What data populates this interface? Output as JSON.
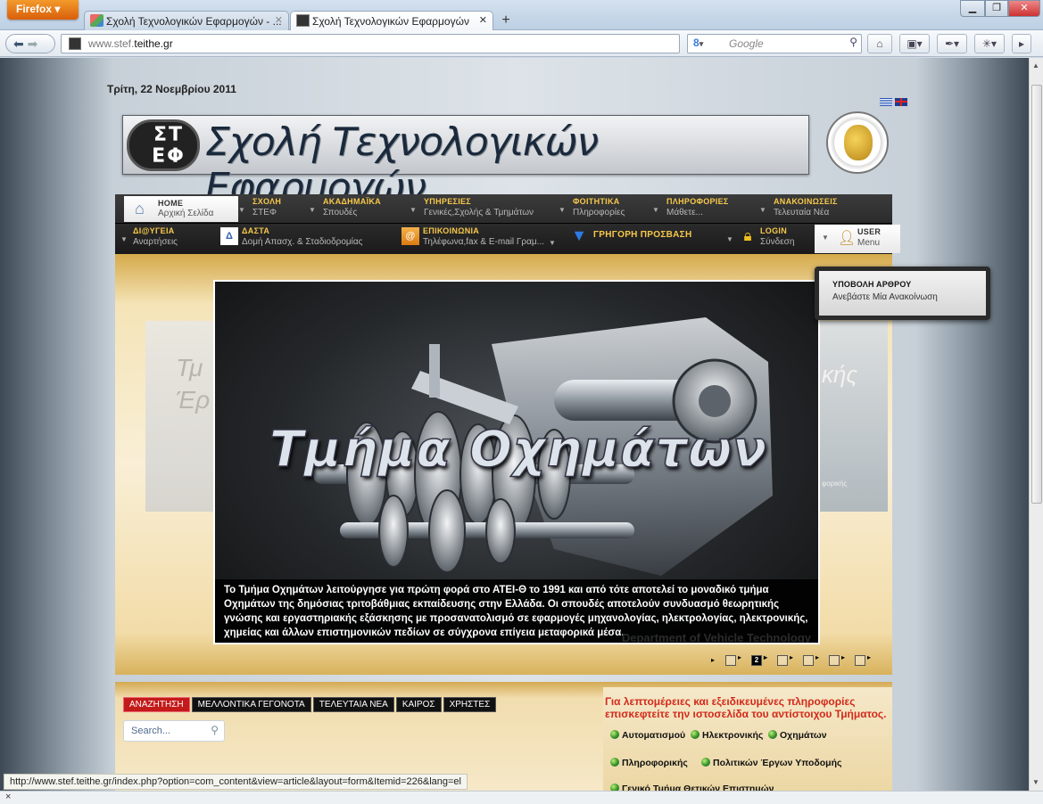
{
  "browser": {
    "app_button": "Firefox",
    "tabs": [
      {
        "title": "Σχολή Τεχνολογικών Εφαρμογών - ..."
      },
      {
        "title": "Σχολή Τεχνολογικών Εφαρμογών"
      }
    ],
    "new_tab": "+",
    "url_prefix": "www.stef.",
    "url_host": "teithe.gr",
    "search_engine": "Google",
    "search_placeholder": "Google",
    "status_url": "http://www.stef.teithe.gr/index.php?option=com_content&view=article&layout=form&Itemid=226&lang=el",
    "statusbar_close": "×"
  },
  "site": {
    "date": "Τρίτη, 22 Νοεμβρίου 2011",
    "banner_logo": "ΣΤ ΕΦ",
    "banner_title": "Σχολή Τεχνολογικών Εφαρμογών",
    "nav_row1": [
      {
        "title": "HOME",
        "sub": "Αρχική Σελίδα"
      },
      {
        "title": "ΣΧΟΛΗ",
        "sub": "ΣΤΕΦ"
      },
      {
        "title": "ΑΚΑΔΗΜΑΪΚΑ",
        "sub": "Σπουδές"
      },
      {
        "title": "ΥΠΗΡΕΣΙΕΣ",
        "sub": "Γενικές,Σχολής & Τμημάτων"
      },
      {
        "title": "ΦΟΙΤΗΤΙΚΑ",
        "sub": "Πληροφορίες"
      },
      {
        "title": "ΠΛΗΡΟΦΟΡΙΕΣ",
        "sub": "Μάθετε..."
      },
      {
        "title": "ΑΝΑΚΟΙΝΩΣΕΙΣ",
        "sub": "Τελευταία Νέα"
      }
    ],
    "nav_row2": [
      {
        "title": "ΔΙ@ΥΓΕΙΑ",
        "sub": "Αναρτήσεις"
      },
      {
        "title": "ΔΑΣΤΑ",
        "sub": "Δομή Απασχ. & Σταδιοδρομίας"
      },
      {
        "title": "ΕΠΙΚΟΙΝΩΝΙΑ",
        "sub": "Τηλέφωνα,fax & E-mail Γραμ..."
      },
      {
        "title": "ΓΡΗΓΟΡΗ ΠΡΟΣΒΑΣΗ",
        "sub": ""
      },
      {
        "title": "LOGIN",
        "sub": "Σύνδεση"
      },
      {
        "title": "USER",
        "sub": "Menu"
      }
    ],
    "user_dropdown": {
      "title": "ΥΠΟΒΟΛΗ ΑΡΘΡΟΥ",
      "item": "Ανεβάστε Μία Ανακοίνωση"
    },
    "slideshow": {
      "title": "Τμήμα Οχημάτων",
      "caption": "Το Τμήμα Οχημάτων λειτούργησε για πρώτη φορά στο ΑΤΕΙ-Θ το 1991 και από τότε αποτελεί το μοναδικό τμήμα Οχημάτων της δημόσιας τριτοβάθμιας εκπαίδευσης στην Ελλάδα. Οι σπουδές αποτελούν συνδυασμό θεωρητικής γνώσης και εργαστηριακής εξάσκησης με προσανατολισμό σε εφαρμογές μηχανολογίας, ηλεκτρολογίας, ηλεκτρονικής, χημείας και άλλων επιστημονικών πεδίων σε σύγχρονα επίγεια μεταφορικά μέσα.",
      "watermark": "Department of Vehicle Technology",
      "ghost_left": "Τμ Έρ",
      "ghost_right": "κής",
      "ghost_right_small": "φορικής",
      "current_page": "2",
      "page_count": 7
    },
    "bottom_tabs": [
      "ΑΝΑΖΗΤΗΣΗ",
      "ΜΕΛΛΟΝΤΙΚΑ ΓΕΓΟΝΟΤΑ",
      "ΤΕΛΕΥΤΑΙΑ ΝΕΑ",
      "ΚΑΙΡΟΣ",
      "ΧΡΗΣΤΕΣ"
    ],
    "search_placeholder": "Search...",
    "departments_heading": "Για λεπτομέρειες και εξειδικευμένες πληροφορίες επισκεφτείτε την ιστοσελίδα του αντίστοιχου Τμήματος.",
    "departments": [
      "Αυτοματισμού",
      "Ηλεκτρονικής",
      "Οχημάτων",
      "Πληροφορικής",
      "Πολιτικών Έργων Υποδομής",
      "Γενικό Τμήμα Θετικών Επιστημών"
    ]
  },
  "colors": {
    "nav_title": "#f7c84a",
    "active_tab": "#c31a1a",
    "heading_red": "#d22a1a"
  }
}
